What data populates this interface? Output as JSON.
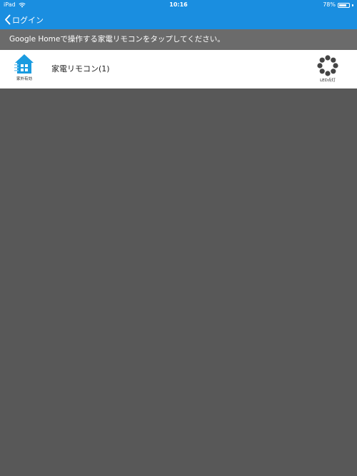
{
  "status_bar": {
    "device": "iPad",
    "time": "10:16",
    "battery_percent": "78%",
    "battery_level": 0.78
  },
  "nav": {
    "back_label": "ログイン"
  },
  "instruction": "Google Homeで操作する家電リモコンをタップしてください。",
  "remotes": [
    {
      "name": "家電リモコン(1)",
      "left_icon": "house-icon",
      "left_caption": "家外有効",
      "right_icon": "led-icon",
      "right_caption": "LED点灯"
    }
  ],
  "colors": {
    "header_blue": "#1a8ee0",
    "instruction_bg": "#6b6b6b",
    "content_bg": "#585858"
  }
}
